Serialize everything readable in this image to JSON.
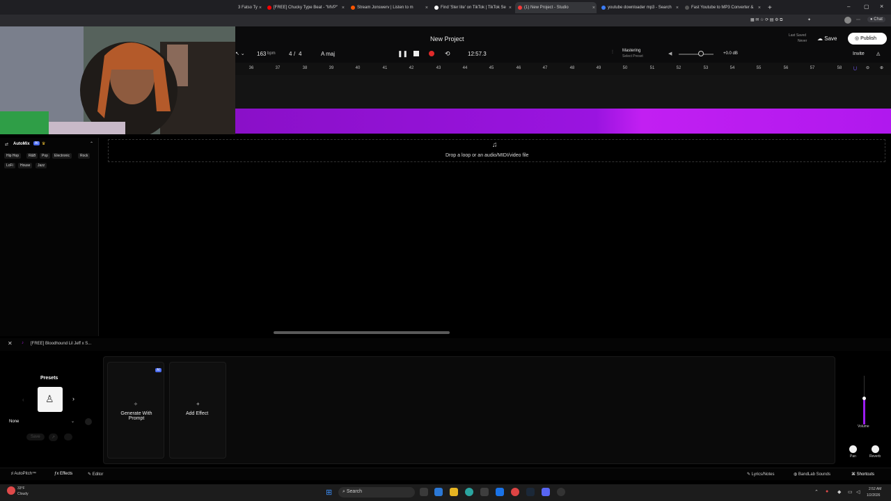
{
  "browser": {
    "tabs": [
      {
        "label": "3 Fatso Ty",
        "color": "#cc2222"
      },
      {
        "label": "[FREE] Chucky Type Beat - \"MVP\"",
        "color": "#ff0000"
      },
      {
        "label": "Stream Jonswerv | Listen to m",
        "color": "#ff5500"
      },
      {
        "label": "Find 'Ster lite' on TikTok | TikTok Se",
        "color": "#ffffff"
      },
      {
        "label": "(1) New Project - Studio",
        "color": "#f43b3b"
      },
      {
        "label": "youtube downloader mp3 - Search",
        "color": "#3b7cf4"
      },
      {
        "label": "Fast Youtube to MP3 Converter &",
        "color": "#555555"
      }
    ],
    "new_tab": "+"
  },
  "daw": {
    "project_title": "New Project",
    "bpm": "163",
    "bpm_unit": "bpm",
    "time_sig_num": "4",
    "time_sig_sep": "/",
    "time_sig_den": "4",
    "key": "A maj",
    "time": "12:57.3",
    "mastering_label": "Mastering",
    "mastering_sub": "Select Preset",
    "db": "+0.0 dB",
    "last_saved_label": "Last Saved",
    "last_saved_value": "Never",
    "save": "Save",
    "publish": "Publish",
    "invite": "Invite",
    "ruler": [
      "36",
      "37",
      "38",
      "39",
      "40",
      "41",
      "42",
      "43",
      "44",
      "45",
      "46",
      "47",
      "48",
      "49",
      "50",
      "51",
      "52",
      "53",
      "54",
      "55",
      "56",
      "57",
      "58"
    ],
    "dropzone_text": "Drop a loop or an audio/MIDI/video file"
  },
  "sidebar": {
    "title": "AutoMix",
    "ai_badge": "AI",
    "genres": [
      "Hip Hop",
      "R&B",
      "Pop",
      "Electronic",
      "Rock",
      "LoFi",
      "House",
      "Jazz"
    ]
  },
  "track_panel": {
    "track_name": "[FREE] Bloodhound Lil Jeff x S...",
    "presets_label": "Presets",
    "preset_value": "None",
    "save": "Save",
    "generate": "Generate With Prompt",
    "ai_badge": "AI",
    "add_effect": "Add Effect",
    "volume": "Volume",
    "volume_level": 0.55,
    "pan": "Pan",
    "reverb": "Reverb"
  },
  "bottom_bar": {
    "autopitch": "AutoPitch™",
    "effects": "Effects",
    "editor": "Editor",
    "lyrics": "Lyrics/Notes",
    "bandlab_sounds": "BandLab Sounds",
    "shortcuts": "Shortcuts"
  },
  "taskbar": {
    "weather_temp": "33°F",
    "weather_cond": "Cloudy",
    "search": "Search",
    "clock_time": "2:52 AM",
    "clock_date": "1/2/2026"
  }
}
